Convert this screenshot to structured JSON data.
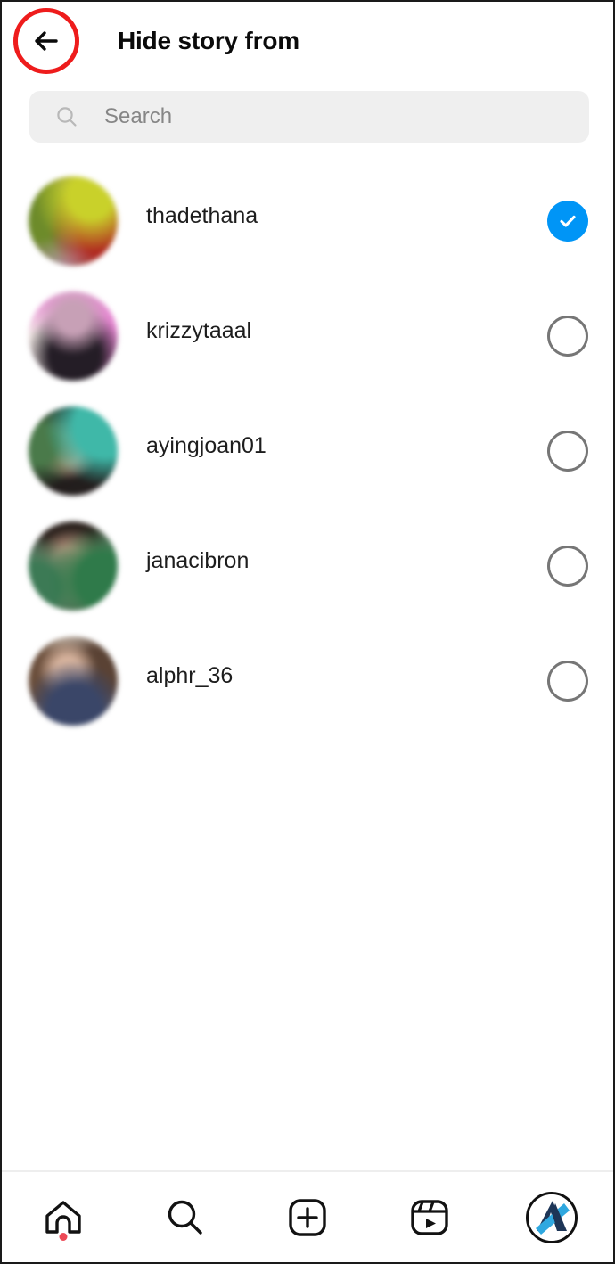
{
  "header": {
    "title": "Hide story from",
    "back_icon": "arrow-left-icon",
    "annotation_color": "#ee1c1c"
  },
  "search": {
    "placeholder": "Search",
    "value": "",
    "icon": "search-icon",
    "background": "#efefef"
  },
  "colors": {
    "accent_blue": "#0095f6",
    "toggle_off_border": "#767676",
    "badge_red": "#ed4956",
    "text_primary": "#1d1d1d",
    "placeholder_gray": "#868686"
  },
  "user_list": [
    {
      "username": "thadethana",
      "subname": "",
      "selected": true,
      "toggle_state": "checked",
      "avatar_name": "avatar-thadethana"
    },
    {
      "username": "krizzytaaal",
      "subname": "",
      "selected": false,
      "toggle_state": "unchecked",
      "avatar_name": "avatar-krizzytaaal"
    },
    {
      "username": "ayingjoan01",
      "subname": "",
      "selected": false,
      "toggle_state": "unchecked",
      "avatar_name": "avatar-ayingjoan01"
    },
    {
      "username": "janacibron",
      "subname": "",
      "selected": false,
      "toggle_state": "unchecked",
      "avatar_name": "avatar-janacibron"
    },
    {
      "username": "alphr_36",
      "subname": "",
      "selected": false,
      "toggle_state": "unchecked",
      "avatar_name": "avatar-alphr_36"
    }
  ],
  "bottom_nav": [
    {
      "name": "home-icon",
      "label": "Home",
      "badge": true
    },
    {
      "name": "search-icon",
      "label": "Search",
      "badge": false
    },
    {
      "name": "create-plus-icon",
      "label": "Create",
      "badge": false
    },
    {
      "name": "reels-icon",
      "label": "Reels",
      "badge": false
    },
    {
      "name": "profile-avatar",
      "label": "Profile",
      "badge": false
    }
  ]
}
